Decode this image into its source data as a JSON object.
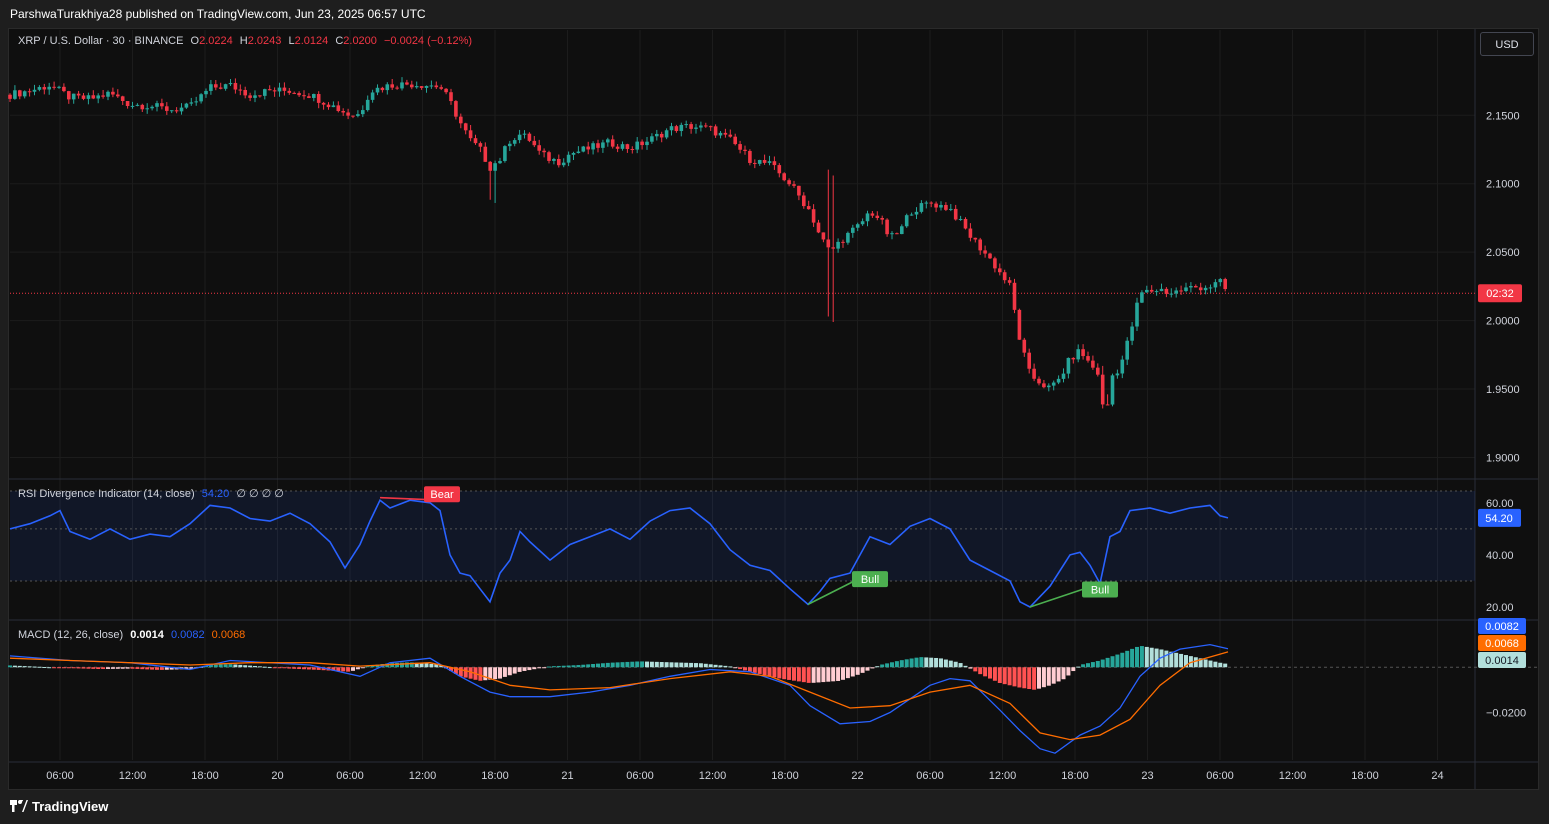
{
  "header": {
    "published": "ParshwaTurakhiya28 published on TradingView.com, Jun 23, 2025 06:57 UTC"
  },
  "symbol_legend": {
    "title": "XRP / U.S. Dollar · 30 · BINANCE",
    "o_label": "O",
    "o_value": "2.0224",
    "h_label": "H",
    "h_value": "2.0243",
    "l_label": "L",
    "l_value": "2.0124",
    "c_label": "C",
    "c_value": "2.0200",
    "change": "−0.0024 (−0.12%)"
  },
  "currency_button": "USD",
  "rsi_legend": {
    "name": "RSI Divergence Indicator (14, close)",
    "value": "54.20",
    "extras": "∅ ∅ ∅ ∅"
  },
  "macd_legend": {
    "name": "MACD (12, 26, close)",
    "hist": "0.0014",
    "macd": "0.0082",
    "signal": "0.0068"
  },
  "footer": {
    "brand": "TradingView"
  },
  "colors": {
    "up": "#26a69a",
    "down": "#f23645",
    "rsi_line": "#2962ff",
    "macd_line": "#2962ff",
    "signal_line": "#ff6d00",
    "bear": "#f23645",
    "bull": "#4caf50",
    "background": "#0f0f0f"
  },
  "chart_data": [
    {
      "type": "candlestick",
      "title": "XRP / U.S. Dollar · 30 · BINANCE",
      "interval": "30",
      "ylim": [
        1.885,
        2.205
      ],
      "y_ticks": [
        "2.1500",
        "2.1000",
        "2.0500",
        "2.0000",
        "1.9500",
        "1.9000"
      ],
      "x_ticks": [
        "06:00",
        "12:00",
        "18:00",
        "20",
        "06:00",
        "12:00",
        "18:00",
        "21",
        "06:00",
        "12:00",
        "18:00",
        "22",
        "06:00",
        "12:00",
        "18:00",
        "23",
        "06:00",
        "12:00",
        "18:00",
        "24"
      ],
      "last_price": 2.02,
      "countdown_label": "02:32",
      "close_path": [
        [
          0,
          2.165
        ],
        [
          20,
          2.168
        ],
        [
          40,
          2.172
        ],
        [
          60,
          2.163
        ],
        [
          80,
          2.162
        ],
        [
          100,
          2.166
        ],
        [
          120,
          2.158
        ],
        [
          140,
          2.157
        ],
        [
          160,
          2.154
        ],
        [
          180,
          2.156
        ],
        [
          200,
          2.17
        ],
        [
          220,
          2.172
        ],
        [
          240,
          2.165
        ],
        [
          260,
          2.168
        ],
        [
          280,
          2.168
        ],
        [
          300,
          2.165
        ],
        [
          320,
          2.158
        ],
        [
          340,
          2.15
        ],
        [
          350,
          2.151
        ],
        [
          360,
          2.168
        ],
        [
          380,
          2.172
        ],
        [
          400,
          2.173
        ],
        [
          420,
          2.172
        ],
        [
          430,
          2.171
        ],
        [
          440,
          2.16
        ],
        [
          450,
          2.145
        ],
        [
          460,
          2.132
        ],
        [
          470,
          2.125
        ],
        [
          480,
          2.112
        ],
        [
          490,
          2.118
        ],
        [
          500,
          2.132
        ],
        [
          510,
          2.136
        ],
        [
          520,
          2.132
        ],
        [
          530,
          2.122
        ],
        [
          540,
          2.118
        ],
        [
          550,
          2.116
        ],
        [
          560,
          2.122
        ],
        [
          580,
          2.126
        ],
        [
          600,
          2.13
        ],
        [
          620,
          2.126
        ],
        [
          640,
          2.132
        ],
        [
          660,
          2.14
        ],
        [
          680,
          2.142
        ],
        [
          700,
          2.14
        ],
        [
          720,
          2.132
        ],
        [
          740,
          2.118
        ],
        [
          760,
          2.114
        ],
        [
          780,
          2.1
        ],
        [
          800,
          2.08
        ],
        [
          810,
          2.062
        ],
        [
          820,
          2.05
        ],
        [
          830,
          2.058
        ],
        [
          850,
          2.07
        ],
        [
          860,
          2.08
        ],
        [
          870,
          2.074
        ],
        [
          880,
          2.06
        ],
        [
          890,
          2.065
        ],
        [
          900,
          2.08
        ],
        [
          920,
          2.086
        ],
        [
          940,
          2.082
        ],
        [
          960,
          2.062
        ],
        [
          980,
          2.045
        ],
        [
          1000,
          2.025
        ],
        [
          1010,
          1.985
        ],
        [
          1020,
          1.96
        ],
        [
          1030,
          1.955
        ],
        [
          1040,
          1.95
        ],
        [
          1050,
          1.958
        ],
        [
          1060,
          1.972
        ],
        [
          1070,
          1.978
        ],
        [
          1080,
          1.968
        ],
        [
          1090,
          1.96
        ],
        [
          1095,
          1.918
        ],
        [
          1100,
          1.958
        ],
        [
          1110,
          1.966
        ],
        [
          1120,
          1.99
        ],
        [
          1130,
          2.02
        ],
        [
          1150,
          2.023
        ],
        [
          1160,
          2.02
        ],
        [
          1180,
          2.024
        ],
        [
          1200,
          2.025
        ],
        [
          1210,
          2.028
        ],
        [
          1218,
          2.02
        ]
      ]
    },
    {
      "type": "line",
      "title": "RSI Divergence Indicator (14, close)",
      "ylim": [
        15,
        68
      ],
      "band": [
        30,
        70
      ],
      "y_ticks": [
        "60.00",
        "40.00",
        "20.00"
      ],
      "value_label": "54.20",
      "series": [
        {
          "values": [
            [
              0,
              50
            ],
            [
              20,
              52
            ],
            [
              40,
              55
            ],
            [
              50,
              57
            ],
            [
              60,
              49
            ],
            [
              80,
              46
            ],
            [
              100,
              50
            ],
            [
              120,
              46
            ],
            [
              140,
              48
            ],
            [
              160,
              47
            ],
            [
              180,
              52
            ],
            [
              200,
              59
            ],
            [
              220,
              58
            ],
            [
              240,
              54
            ],
            [
              260,
              53
            ],
            [
              280,
              56
            ],
            [
              300,
              52
            ],
            [
              320,
              45
            ],
            [
              335,
              35
            ],
            [
              350,
              44
            ],
            [
              360,
              53
            ],
            [
              370,
              61
            ],
            [
              380,
              58
            ],
            [
              400,
              61
            ],
            [
              420,
              60
            ],
            [
              430,
              57
            ],
            [
              440,
              40
            ],
            [
              450,
              33
            ],
            [
              460,
              32
            ],
            [
              470,
              27
            ],
            [
              480,
              22
            ],
            [
              490,
              33
            ],
            [
              500,
              38
            ],
            [
              510,
              49
            ],
            [
              520,
              45
            ],
            [
              540,
              38
            ],
            [
              560,
              44
            ],
            [
              580,
              47
            ],
            [
              600,
              50
            ],
            [
              620,
              46
            ],
            [
              640,
              53
            ],
            [
              660,
              57
            ],
            [
              680,
              58
            ],
            [
              700,
              52
            ],
            [
              720,
              42
            ],
            [
              740,
              36
            ],
            [
              760,
              34
            ],
            [
              780,
              27
            ],
            [
              798,
              21
            ],
            [
              810,
              26
            ],
            [
              820,
              31
            ],
            [
              840,
              33
            ],
            [
              860,
              47
            ],
            [
              880,
              44
            ],
            [
              900,
              51
            ],
            [
              920,
              54
            ],
            [
              940,
              50
            ],
            [
              960,
              38
            ],
            [
              980,
              34
            ],
            [
              1000,
              30
            ],
            [
              1010,
              22
            ],
            [
              1020,
              20
            ],
            [
              1040,
              28
            ],
            [
              1060,
              40
            ],
            [
              1070,
              41
            ],
            [
              1080,
              36
            ],
            [
              1090,
              29
            ],
            [
              1100,
              47
            ],
            [
              1110,
              49
            ],
            [
              1120,
              57
            ],
            [
              1140,
              58
            ],
            [
              1160,
              56
            ],
            [
              1180,
              58
            ],
            [
              1200,
              59
            ],
            [
              1210,
              55
            ],
            [
              1218,
              54.2
            ]
          ]
        }
      ],
      "signals": [
        {
          "label": "Bear",
          "x_from": 370,
          "y_from": 62,
          "x_to": 432,
          "y_to": 61
        },
        {
          "label": "Bull",
          "x_from": 798,
          "y_from": 21,
          "x_to": 860,
          "y_to": 33
        },
        {
          "label": "Bull",
          "x_from": 1020,
          "y_from": 20,
          "x_to": 1090,
          "y_to": 29
        }
      ]
    },
    {
      "type": "bar",
      "title": "MACD (12, 26, close)",
      "ylim": [
        -0.041,
        0.02
      ],
      "y_ticks": [
        "−0.0200"
      ],
      "value_labels": [
        "0.0082",
        "0.0068",
        "0.0014"
      ],
      "series": [
        {
          "values": [
            [
              0,
              0.005
            ],
            [
              60,
              0.003
            ],
            [
              120,
              0.002
            ],
            [
              180,
              -0.001
            ],
            [
              220,
              0.003
            ],
            [
              300,
              0.001
            ],
            [
              350,
              -0.004
            ],
            [
              380,
              0.002
            ],
            [
              420,
              0.004
            ],
            [
              450,
              -0.004
            ],
            [
              480,
              -0.011
            ],
            [
              500,
              -0.013
            ],
            [
              540,
              -0.013
            ],
            [
              580,
              -0.011
            ],
            [
              620,
              -0.008
            ],
            [
              660,
              -0.004
            ],
            [
              700,
              -0.001
            ],
            [
              740,
              -0.002
            ],
            [
              780,
              -0.008
            ],
            [
              800,
              -0.017
            ],
            [
              830,
              -0.025
            ],
            [
              860,
              -0.024
            ],
            [
              880,
              -0.02
            ],
            [
              900,
              -0.014
            ],
            [
              920,
              -0.008
            ],
            [
              940,
              -0.005
            ],
            [
              960,
              -0.006
            ],
            [
              990,
              -0.019
            ],
            [
              1010,
              -0.028
            ],
            [
              1030,
              -0.036
            ],
            [
              1045,
              -0.038
            ],
            [
              1070,
              -0.03
            ],
            [
              1090,
              -0.026
            ],
            [
              1110,
              -0.018
            ],
            [
              1130,
              -0.004
            ],
            [
              1150,
              0.004
            ],
            [
              1170,
              0.008
            ],
            [
              1200,
              0.01
            ],
            [
              1218,
              0.0082
            ]
          ]
        },
        {
          "values": [
            [
              0,
              0.004
            ],
            [
              60,
              0.003
            ],
            [
              120,
              0.002
            ],
            [
              180,
              0.001
            ],
            [
              240,
              0.002
            ],
            [
              300,
              0.002
            ],
            [
              350,
              0.0005
            ],
            [
              420,
              0.002
            ],
            [
              460,
              -0.002
            ],
            [
              500,
              -0.008
            ],
            [
              540,
              -0.01
            ],
            [
              600,
              -0.009
            ],
            [
              660,
              -0.005
            ],
            [
              720,
              -0.002
            ],
            [
              760,
              -0.004
            ],
            [
              800,
              -0.011
            ],
            [
              840,
              -0.018
            ],
            [
              880,
              -0.017
            ],
            [
              920,
              -0.011
            ],
            [
              960,
              -0.008
            ],
            [
              1000,
              -0.016
            ],
            [
              1030,
              -0.029
            ],
            [
              1060,
              -0.032
            ],
            [
              1090,
              -0.03
            ],
            [
              1120,
              -0.023
            ],
            [
              1150,
              -0.008
            ],
            [
              1180,
              0.002
            ],
            [
              1218,
              0.0068
            ]
          ]
        }
      ],
      "histogram": [
        [
          0,
          0.0008
        ],
        [
          30,
          0.0002
        ],
        [
          60,
          -0.0004
        ],
        [
          90,
          -0.0008
        ],
        [
          120,
          -0.0006
        ],
        [
          150,
          -0.0012
        ],
        [
          180,
          -0.0008
        ],
        [
          200,
          0.001
        ],
        [
          220,
          0.0014
        ],
        [
          250,
          0.0004
        ],
        [
          280,
          -0.0006
        ],
        [
          310,
          -0.0012
        ],
        [
          340,
          -0.002
        ],
        [
          360,
          0.0008
        ],
        [
          380,
          0.0018
        ],
        [
          400,
          0.0022
        ],
        [
          430,
          0.0012
        ],
        [
          450,
          -0.004
        ],
        [
          470,
          -0.006
        ],
        [
          490,
          -0.005
        ],
        [
          510,
          -0.002
        ],
        [
          540,
          0.0004
        ],
        [
          570,
          0.001
        ],
        [
          600,
          0.002
        ],
        [
          630,
          0.0026
        ],
        [
          660,
          0.0022
        ],
        [
          690,
          0.0018
        ],
        [
          720,
          0.0004
        ],
        [
          740,
          -0.002
        ],
        [
          770,
          -0.005
        ],
        [
          800,
          -0.007
        ],
        [
          830,
          -0.006
        ],
        [
          850,
          -0.003
        ],
        [
          870,
          0.001
        ],
        [
          890,
          0.003
        ],
        [
          910,
          0.0045
        ],
        [
          930,
          0.004
        ],
        [
          950,
          0.002
        ],
        [
          970,
          -0.003
        ],
        [
          990,
          -0.007
        ],
        [
          1010,
          -0.009
        ],
        [
          1025,
          -0.01
        ],
        [
          1040,
          -0.008
        ],
        [
          1055,
          -0.005
        ],
        [
          1070,
          0.001
        ],
        [
          1090,
          0.003
        ],
        [
          1110,
          0.006
        ],
        [
          1130,
          0.0095
        ],
        [
          1150,
          0.008
        ],
        [
          1170,
          0.006
        ],
        [
          1190,
          0.004
        ],
        [
          1210,
          0.002
        ],
        [
          1218,
          0.0014
        ]
      ]
    }
  ]
}
